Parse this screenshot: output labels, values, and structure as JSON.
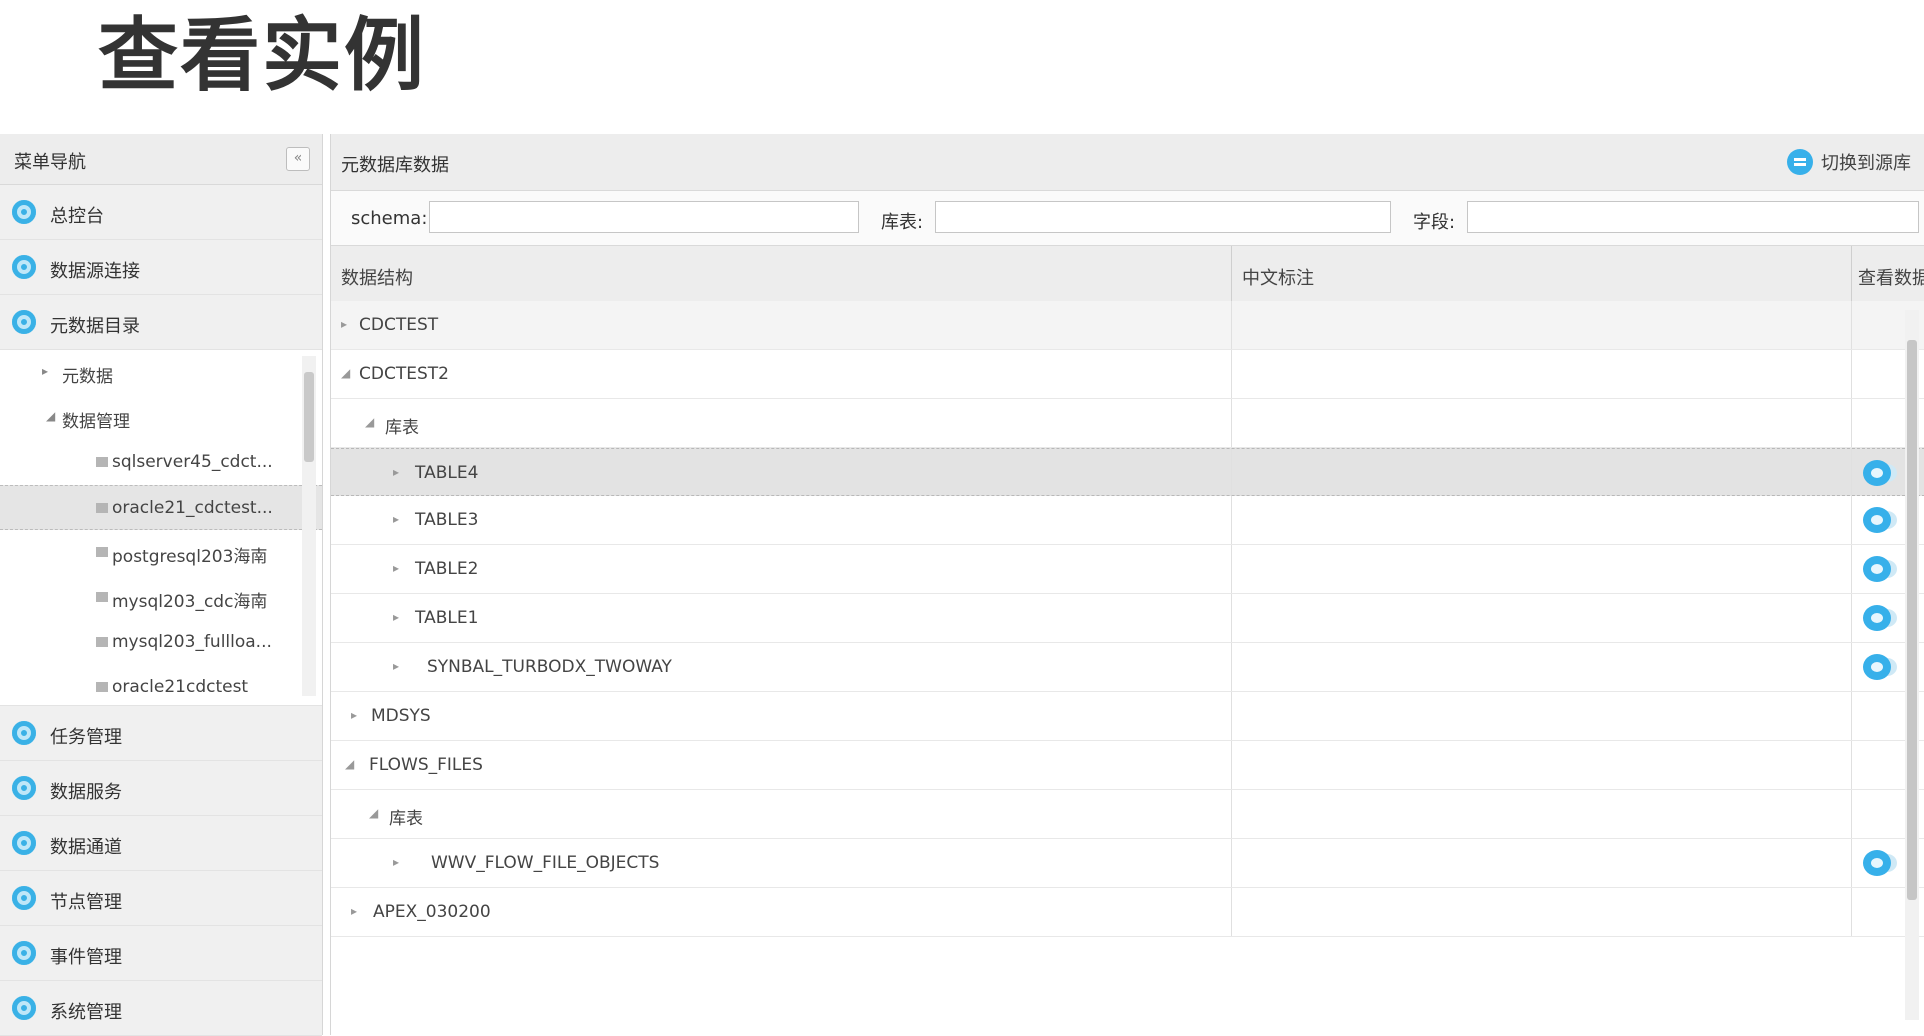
{
  "slide_title": "查看实例",
  "sidebar": {
    "title": "菜单导航",
    "collapse_glyph": "«",
    "items": [
      {
        "label": "总控台"
      },
      {
        "label": "数据源连接"
      },
      {
        "label": "元数据目录"
      }
    ],
    "submenu": [
      {
        "label": "元数据",
        "toggle": "▸"
      },
      {
        "label": "数据管理",
        "toggle": "◢"
      },
      {
        "label": "sqlserver45_cdct..."
      },
      {
        "label": "oracle21_cdctest..."
      },
      {
        "label": "postgresql203海南"
      },
      {
        "label": "mysql203_cdc海南"
      },
      {
        "label": "mysql203_fullloa..."
      },
      {
        "label": "oracle21cdctest"
      }
    ],
    "items_after": [
      {
        "label": "任务管理"
      },
      {
        "label": "数据服务"
      },
      {
        "label": "数据通道"
      },
      {
        "label": "节点管理"
      },
      {
        "label": "事件管理"
      },
      {
        "label": "系统管理"
      }
    ]
  },
  "main": {
    "title": "元数据库数据",
    "switch_label": "切换到源库",
    "filters": {
      "schema_label": "schema:",
      "table_label": "库表:",
      "field_label": "字段:"
    },
    "columns": {
      "structure": "数据结构",
      "comment": "中文标注",
      "view": "查看数据"
    },
    "rows": [
      {
        "label": "CDCTEST",
        "arrow": "▸"
      },
      {
        "label": "CDCTEST2",
        "arrow": "◢"
      },
      {
        "label": "库表",
        "arrow": "◢"
      },
      {
        "label": "TABLE4",
        "arrow": "▸"
      },
      {
        "label": "TABLE3",
        "arrow": "▸"
      },
      {
        "label": "TABLE2",
        "arrow": "▸"
      },
      {
        "label": "TABLE1",
        "arrow": "▸"
      },
      {
        "label": "SYNBAL_TURBODX_TWOWAY",
        "arrow": "▸"
      },
      {
        "label": "MDSYS",
        "arrow": "▸"
      },
      {
        "label": "FLOWS_FILES",
        "arrow": "◢"
      },
      {
        "label": "库表",
        "arrow": "◢"
      },
      {
        "label": "WWV_FLOW_FILE_OBJECTS",
        "arrow": "▸"
      },
      {
        "label": "APEX_030200",
        "arrow": "▸"
      }
    ]
  },
  "colors": {
    "accent": "#37b0ea",
    "selected_row": "#e3e3e3",
    "header_bg": "#ededed"
  }
}
